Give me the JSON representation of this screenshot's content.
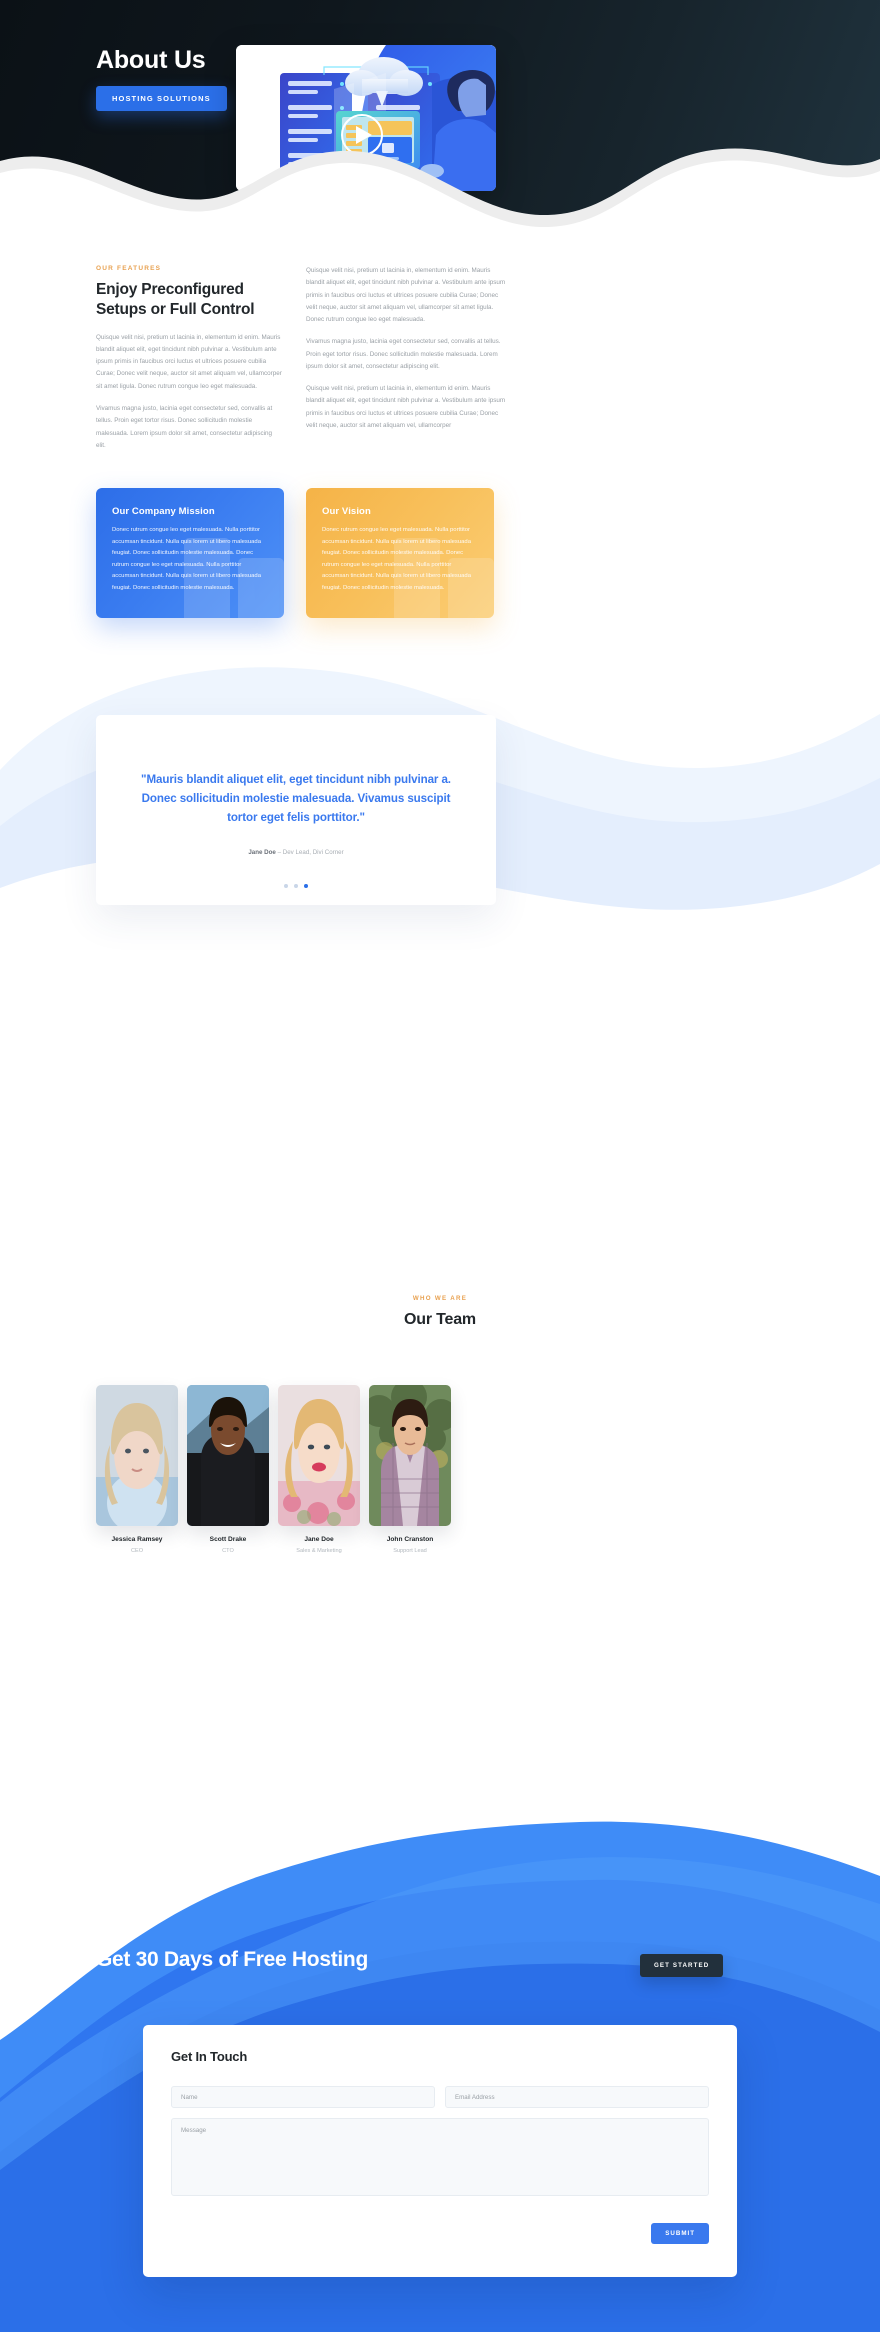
{
  "hero": {
    "title": "About Us",
    "button_label": "HOSTING SOLUTIONS",
    "image_alt": "hosting-illustration"
  },
  "features": {
    "eyebrow": "OUR FEATURES",
    "heading": "Enjoy Preconfigured Setups or Full Control",
    "left_paragraphs": [
      "Quisque velit nisi, pretium ut lacinia in, elementum id enim. Mauris blandit aliquet elit, eget tincidunt nibh pulvinar a. Vestibulum ante ipsum primis in faucibus orci luctus et ultrices posuere cubilia Curae; Donec velit neque, auctor sit amet aliquam vel, ullamcorper sit amet ligula. Donec rutrum congue leo eget malesuada.",
      "Vivamus magna justo, lacinia eget consectetur sed, convallis at tellus. Proin eget tortor risus. Donec sollicitudin molestie malesuada. Lorem ipsum dolor sit amet, consectetur adipiscing elit."
    ],
    "right_paragraphs": [
      "Quisque velit nisi, pretium ut lacinia in, elementum id enim. Mauris blandit aliquet elit, eget tincidunt nibh pulvinar a. Vestibulum ante ipsum primis in faucibus orci luctus et ultrices posuere cubilia Curae; Donec velit neque, auctor sit amet aliquam vel, ullamcorper sit amet ligula. Donec rutrum congue leo eget malesuada.",
      "Vivamus magna justo, lacinia eget consectetur sed, convallis at tellus. Proin eget tortor risus. Donec sollicitudin molestie malesuada. Lorem ipsum dolor sit amet, consectetur adipiscing elit.",
      "Quisque velit nisi, pretium ut lacinia in, elementum id enim. Mauris blandit aliquet elit, eget tincidunt nibh pulvinar a. Vestibulum ante ipsum primis in faucibus orci luctus et ultrices posuere cubilia Curae; Donec velit neque, auctor sit amet aliquam vel, ullamcorper"
    ]
  },
  "cards": {
    "mission": {
      "title": "Our Company Mission",
      "body": "Donec rutrum congue leo eget malesuada. Nulla porttitor accumsan tincidunt. Nulla quis lorem ut libero malesuada feugiat. Donec sollicitudin molestie malesuada. Donec rutrum congue leo eget malesuada. Nulla porttitor accumsan tincidunt. Nulla quis lorem ut libero malesuada feugiat. Donec sollicitudin molestie malesuada.",
      "color": "#2d6ee8"
    },
    "vision": {
      "title": "Our Vision",
      "body": "Donec rutrum congue leo eget malesuada. Nulla porttitor accumsan tincidunt. Nulla quis lorem ut libero malesuada feugiat. Donec sollicitudin molestie malesuada. Donec rutrum congue leo eget malesuada. Nulla porttitor accumsan tincidunt. Nulla quis lorem ut libero malesuada feugiat. Donec sollicitudin molestie malesuada.",
      "color": "#f5b347"
    }
  },
  "testimonial": {
    "quote": "\"Mauris blandit aliquet elit, eget tincidunt nibh pulvinar a. Donec sollicitudin molestie malesuada. Vivamus suscipit tortor eget felis porttitor.\"",
    "author_name": "Jane Doe",
    "author_role": "– Dev Lead, Divi Corner",
    "slide_count": 3,
    "active_slide": 3,
    "quote_color": "#3a79ee"
  },
  "team": {
    "eyebrow": "WHO WE ARE",
    "title": "Our Team",
    "members": [
      {
        "name": "Jessica Ramsey",
        "role": "CEO",
        "photo": "blonde-woman-portrait"
      },
      {
        "name": "Scott Drake",
        "role": "CTO",
        "photo": "man-smiling-portrait"
      },
      {
        "name": "Jane Doe",
        "role": "Sales & Marketing",
        "photo": "woman-pink-lips-portrait"
      },
      {
        "name": "John Cranston",
        "role": "Support Lead",
        "photo": "man-plaid-shirt-portrait"
      }
    ]
  },
  "cta": {
    "title": "Get 30 Days of Free Hosting",
    "button_label": "GET STARTED",
    "form": {
      "title": "Get In Touch",
      "name_placeholder": "Name",
      "name_value": "",
      "email_placeholder": "Email Address",
      "email_value": "",
      "message_placeholder": "Message",
      "message_value": "",
      "submit_label": "SUBMIT",
      "submit_color": "#3a79ee"
    },
    "background_color": "#2b6fe8"
  }
}
